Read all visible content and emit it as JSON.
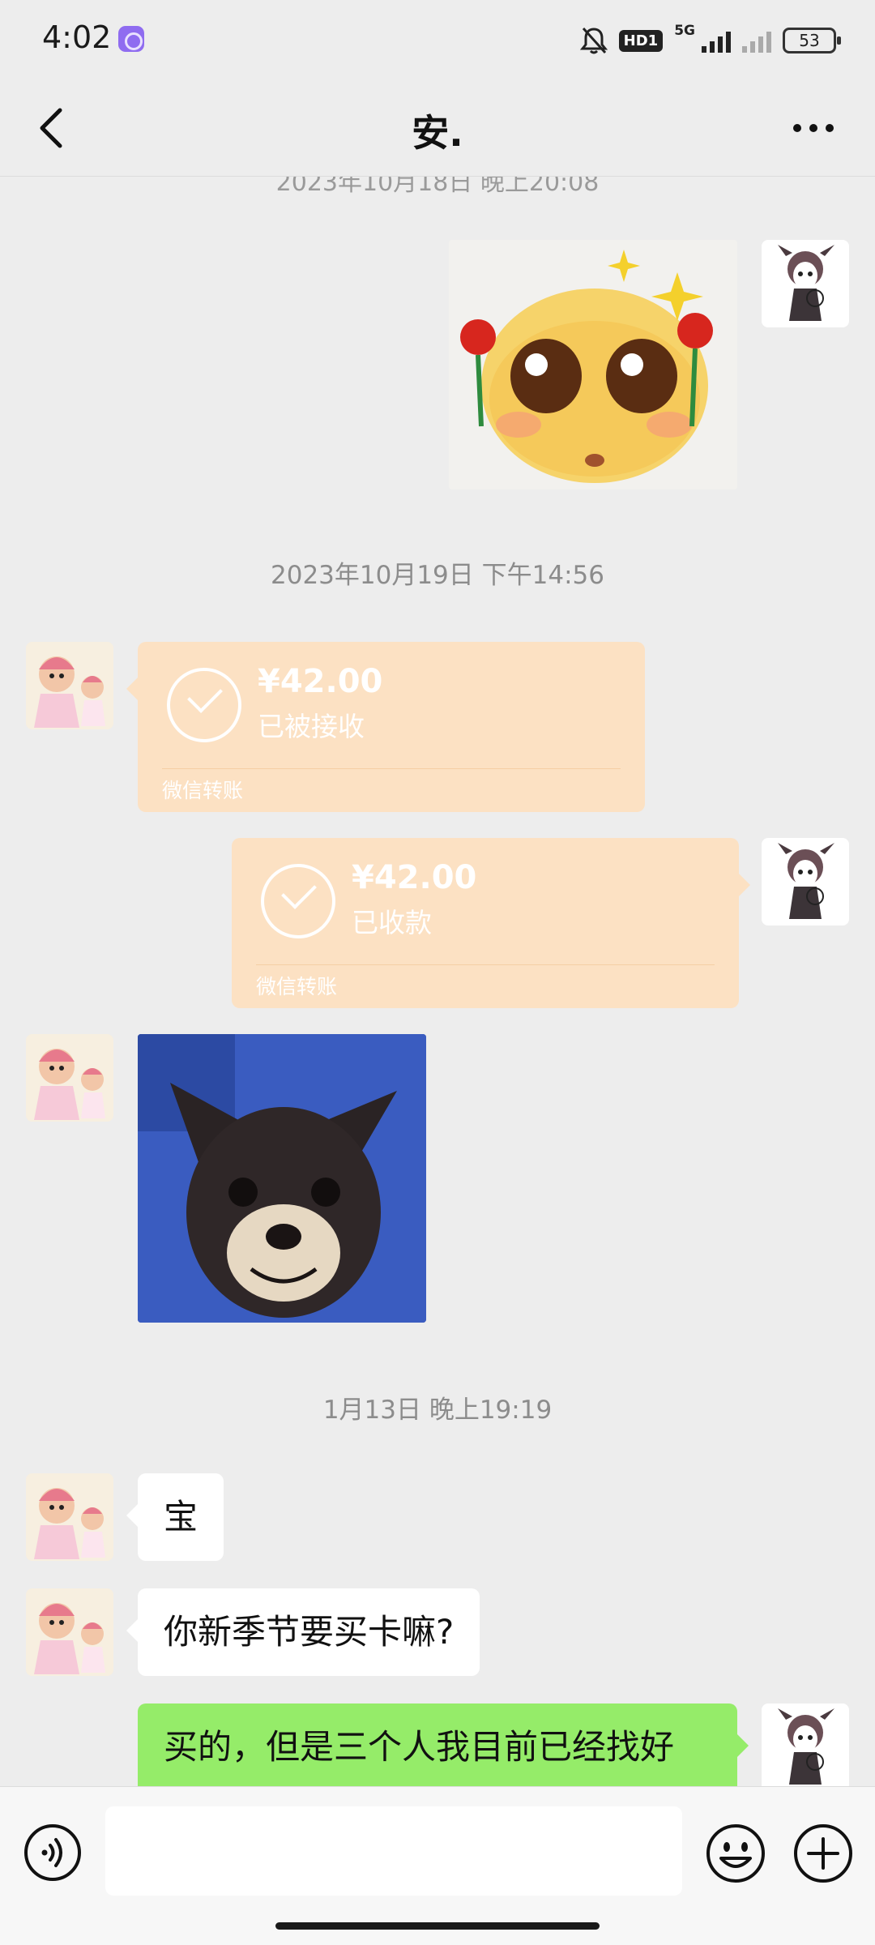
{
  "status_bar": {
    "time": "4:02",
    "network_badge": "HD1",
    "network_type": "5G",
    "battery": "53"
  },
  "header": {
    "title": "安."
  },
  "chat": {
    "cut_timestamp": "2023年10月18日 晚上20:08",
    "timestamp_1": "2023年10月19日 下午14:56",
    "transfer_received": {
      "amount": "¥42.00",
      "status": "已被接收",
      "label": "微信转账"
    },
    "transfer_collected": {
      "amount": "¥42.00",
      "status": "已收款",
      "label": "微信转账"
    },
    "timestamp_2": "1月13日 晚上19:19",
    "message_1": "宝",
    "message_2": "你新季节要买卡嘛?",
    "message_3": "买的，但是三个人我目前已经找好"
  },
  "icons": {
    "back": "chevron-left-icon",
    "more": "more-dots-icon",
    "voice": "voice-icon",
    "emoji": "smiley-icon",
    "plus": "plus-icon",
    "mute": "bell-off-icon"
  },
  "colors": {
    "background": "#ededed",
    "transfer_card": "#fce1c3",
    "my_bubble": "#95ec69",
    "their_bubble": "#ffffff"
  }
}
